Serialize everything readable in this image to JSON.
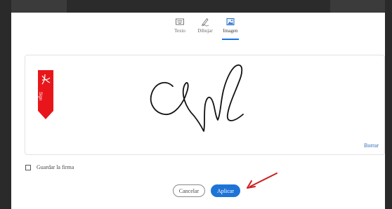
{
  "tabs": [
    {
      "label": "Texto",
      "icon": "keyboard-icon"
    },
    {
      "label": "Dibujar",
      "icon": "pen-draw-icon"
    },
    {
      "label": "Imagen",
      "icon": "image-icon"
    }
  ],
  "active_tab": "Imagen",
  "signature_box": {
    "ribbon_text": "Sign",
    "clear_label": "Borrar"
  },
  "save_signature_label": "Guardar la firma",
  "save_signature_checked": false,
  "buttons": {
    "cancel_label": "Cancelar",
    "apply_label": "Aplicar"
  },
  "colors": {
    "accent": "#1e74d6",
    "ribbon": "#e8161b",
    "annotation_arrow": "#cc1f1f"
  }
}
